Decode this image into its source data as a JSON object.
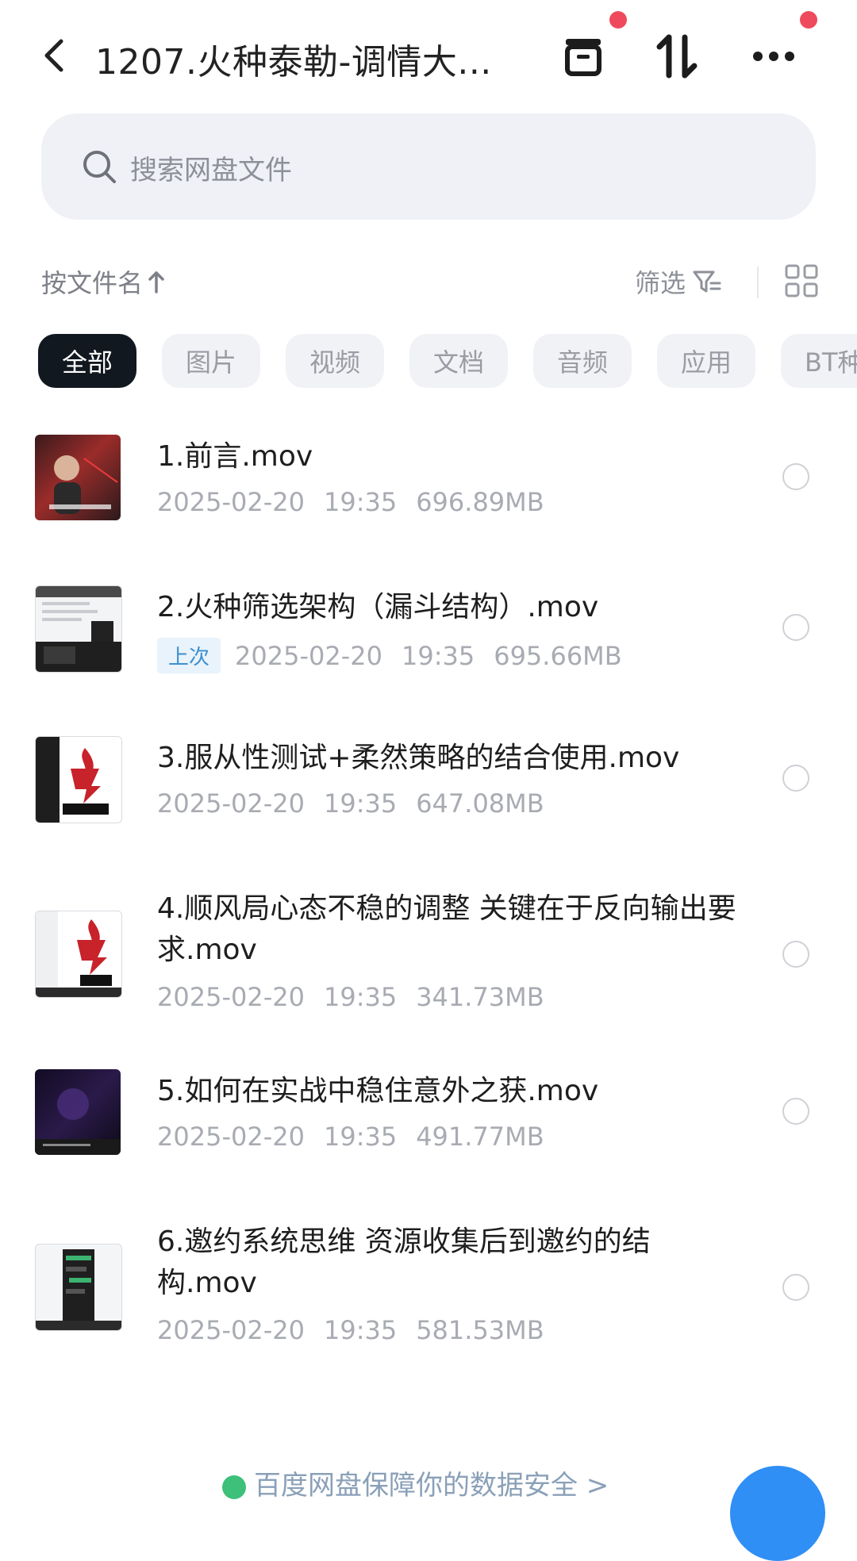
{
  "header": {
    "title": "1207.火种泰勒-调情大..."
  },
  "search": {
    "placeholder": "搜索网盘文件"
  },
  "toolbar": {
    "sort_label": "按文件名",
    "filter_label": "筛选"
  },
  "tabs": [
    {
      "label": "全部",
      "active": true
    },
    {
      "label": "图片"
    },
    {
      "label": "视频"
    },
    {
      "label": "文档"
    },
    {
      "label": "音频"
    },
    {
      "label": "应用"
    },
    {
      "label": "BT种"
    }
  ],
  "files": [
    {
      "name": "1.前言.mov",
      "date": "2025-02-20",
      "time": "19:35",
      "size": "696.89MB"
    },
    {
      "name": "2.火种筛选架构（漏斗结构）.mov",
      "tag": "上次",
      "date": "2025-02-20",
      "time": "19:35",
      "size": "695.66MB"
    },
    {
      "name": "3.服从性测试+柔然策略的结合使用.mov",
      "date": "2025-02-20",
      "time": "19:35",
      "size": "647.08MB"
    },
    {
      "name": "4.顺风局心态不稳的调整  关键在于反向输出要求.mov",
      "date": "2025-02-20",
      "time": "19:35",
      "size": "341.73MB"
    },
    {
      "name": "5.如何在实战中稳住意外之获.mov",
      "date": "2025-02-20",
      "time": "19:35",
      "size": "491.77MB"
    },
    {
      "name": "6.邀约系统思维 资源收集后到邀约的结构.mov",
      "date": "2025-02-20",
      "time": "19:35",
      "size": "581.53MB"
    }
  ],
  "footer": {
    "text": "百度网盘保障你的数据安全 >"
  },
  "colors": {
    "accent": "#2f8ff5",
    "notification_dot": "#ef4a5b",
    "active_tab_bg": "#12181f"
  }
}
